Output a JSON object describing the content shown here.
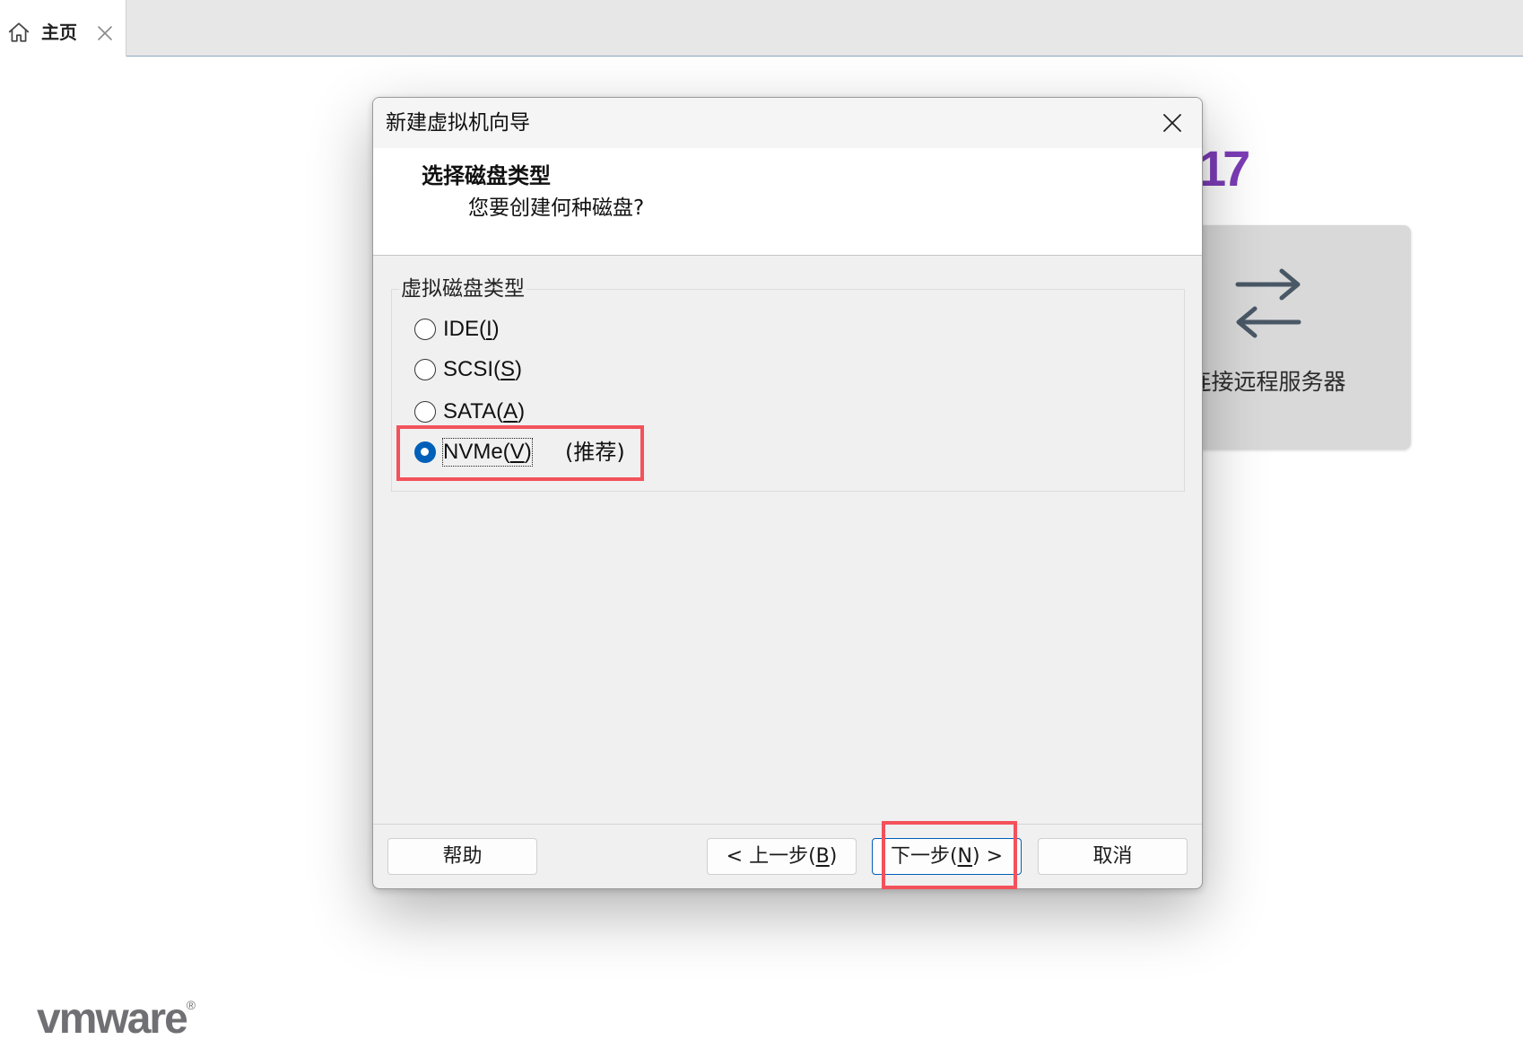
{
  "tabbar": {
    "tab": {
      "icon": "home-icon",
      "label": "主页",
      "close_icon": "close-icon"
    }
  },
  "home_page": {
    "version_fragment": "17",
    "card": {
      "icon": "swap-arrows-icon",
      "label": "连接远程服务器"
    },
    "logo": {
      "text": "vmware",
      "mark": "®"
    }
  },
  "dialog": {
    "title": "新建虚拟机向导",
    "close_icon": "close-icon",
    "header": {
      "title": "选择磁盘类型",
      "subtitle": "您要创建何种磁盘?"
    },
    "group": {
      "legend": "虚拟磁盘类型",
      "options": [
        {
          "prefix": "IDE(",
          "key": "I",
          "suffix": ")",
          "selected": false
        },
        {
          "prefix": "SCSI(",
          "key": "S",
          "suffix": ")",
          "selected": false
        },
        {
          "prefix": "SATA(",
          "key": "A",
          "suffix": ")",
          "selected": false
        },
        {
          "prefix": "NVMe(",
          "key": "V",
          "suffix": ")",
          "note": "(推荐)",
          "selected": true
        }
      ]
    },
    "buttons": {
      "help": {
        "label": "帮助"
      },
      "back": {
        "prefix": "< 上一步(",
        "key": "B",
        "suffix": ")"
      },
      "next": {
        "prefix": "下一步(",
        "key": "N",
        "suffix": ") >",
        "is_default": true
      },
      "cancel": {
        "label": "取消"
      }
    }
  },
  "colors": {
    "accent": "#005fb8",
    "version": "#7c3cb7",
    "highlight": "#f3525b"
  }
}
